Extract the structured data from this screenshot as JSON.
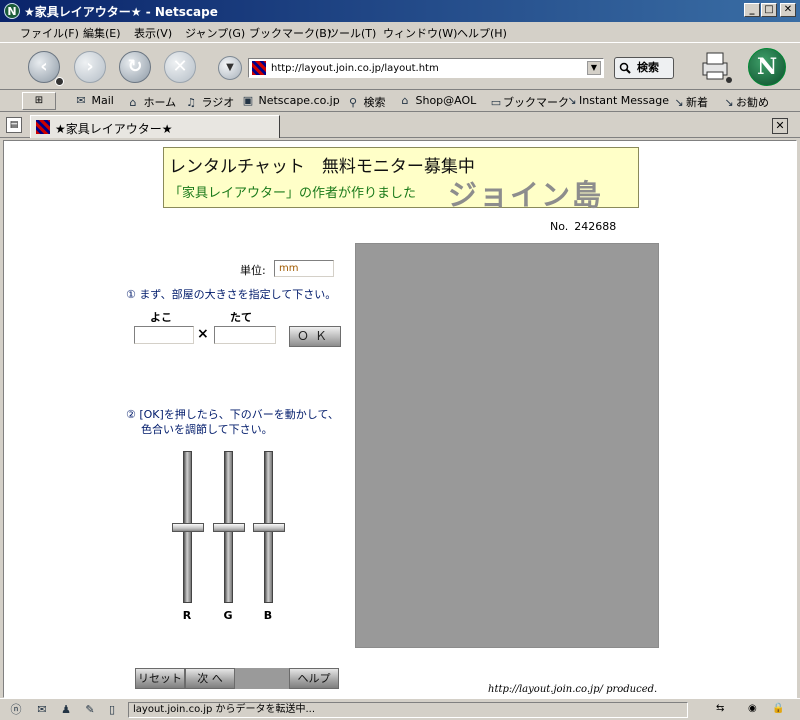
{
  "window": {
    "title": "★家具レイアウター★ - Netscape",
    "controls": {
      "minimize": "_",
      "maximize": "□",
      "close": "✕"
    }
  },
  "menu": [
    "ファイル(F)",
    "編集(E)",
    "表示(V)",
    "ジャンプ(G)",
    "ブックマーク(B)",
    "ツール(T)",
    "ウィンドウ(W)",
    "ヘルプ(H)"
  ],
  "navigation": {
    "url": "http://layout.join.co.jp/layout.htm",
    "search_label": "検索",
    "icons": [
      "back-icon",
      "forward-icon",
      "reload-icon",
      "stop-icon",
      "print-icon",
      "netscape-logo-icon"
    ]
  },
  "personal_toolbar": {
    "items": [
      {
        "label": "Mail",
        "icon": "mail-icon"
      },
      {
        "label": "ホーム",
        "icon": "home-icon"
      },
      {
        "label": "ラジオ",
        "icon": "radio-icon"
      },
      {
        "label": "Netscape.co.jp",
        "icon": "my-icon"
      },
      {
        "label": "検索",
        "icon": "search-icon"
      },
      {
        "label": "Shop@AOL",
        "icon": "shop-icon"
      },
      {
        "label": "ブックマーク",
        "icon": "bookmark-folder-icon"
      },
      {
        "label": "Instant Message",
        "icon": "bookmark-icon"
      },
      {
        "label": "新着",
        "icon": "bookmark-icon"
      },
      {
        "label": "お勧め",
        "icon": "bookmark-icon"
      }
    ]
  },
  "tab": {
    "title": "★家具レイアウター★"
  },
  "page": {
    "banner": {
      "line1": "レンタルチャット　無料モニター募集中",
      "line2": "「家具レイアウター」の作者が作りました",
      "brand": "ジョイン島"
    },
    "counter": {
      "label": "No.",
      "value": "242688"
    },
    "unit": {
      "label": "単位:",
      "value": "mm"
    },
    "step1": "① まず、部屋の大きさを指定して下さい。",
    "width_label": "よこ",
    "height_label": "たて",
    "times": "×",
    "width_value": "",
    "height_value": "",
    "ok_label": "ＯＫ",
    "step2_line1": "② [OK]を押したら、下のバーを動かして、",
    "step2_line2": "色合いを調節して下さい。",
    "sliders": [
      {
        "label": "R",
        "level": 0.5
      },
      {
        "label": "G",
        "level": 0.5
      },
      {
        "label": "B",
        "level": 0.5
      }
    ],
    "preview_color": "#999999",
    "buttons": {
      "reset": "リセット",
      "next": "次 へ",
      "help": "ヘルプ"
    },
    "produced": "http://layout.join.co.jp/  produced."
  },
  "status": {
    "text": "layout.join.co.jp からデータを転送中..."
  }
}
